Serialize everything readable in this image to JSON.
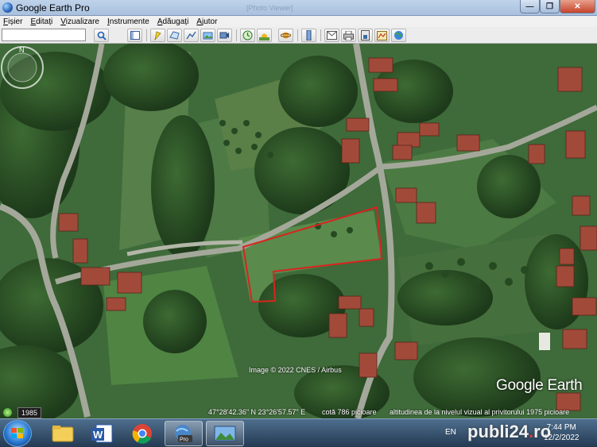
{
  "window": {
    "title": "Google Earth Pro",
    "ghost_title": "[Photo Viewer]"
  },
  "window_controls": {
    "minimize": "—",
    "maximize": "❐",
    "close": "✕"
  },
  "menu": [
    "Fișier",
    "Editați",
    "Vizualizare",
    "Instrumente",
    "Adăugați",
    "Ajutor"
  ],
  "search": {
    "value": ""
  },
  "toolbar_icons": [
    "search-icon",
    "sidebar-toggle-icon",
    "placemark-icon",
    "polygon-icon",
    "path-icon",
    "image-overlay-icon",
    "record-tour-icon",
    "historical-imagery-icon",
    "sunlight-icon",
    "planets-icon",
    "ruler-icon",
    "email-icon",
    "print-icon",
    "save-image-icon",
    "view-in-maps-icon",
    "earth-icon"
  ],
  "map": {
    "image_credit": "Image © 2022 CNES / Airbus",
    "logo": "Google Earth"
  },
  "status": {
    "year": "1985",
    "coordinates": "47°28'42.36\" N   23°26'57.57\" E",
    "elevation": "cotă   786 picioare",
    "eye_altitude": "altitudinea de la nivelul vizual al privitorului   1975 picioare"
  },
  "taskbar": {
    "apps": [
      "windows-explorer",
      "microsoft-word",
      "google-chrome",
      "google-earth-pro",
      "photo-viewer"
    ],
    "pro_label": "Pro",
    "language": "EN",
    "time": "7:44 PM",
    "date": "12/2/2022"
  },
  "watermark": {
    "text1": "publi24",
    "dot": ".",
    "text2": "ro"
  },
  "colors": {
    "parcel_outline": "#d9231f",
    "road": "#9a9e92",
    "roof": "#a24a3a"
  }
}
